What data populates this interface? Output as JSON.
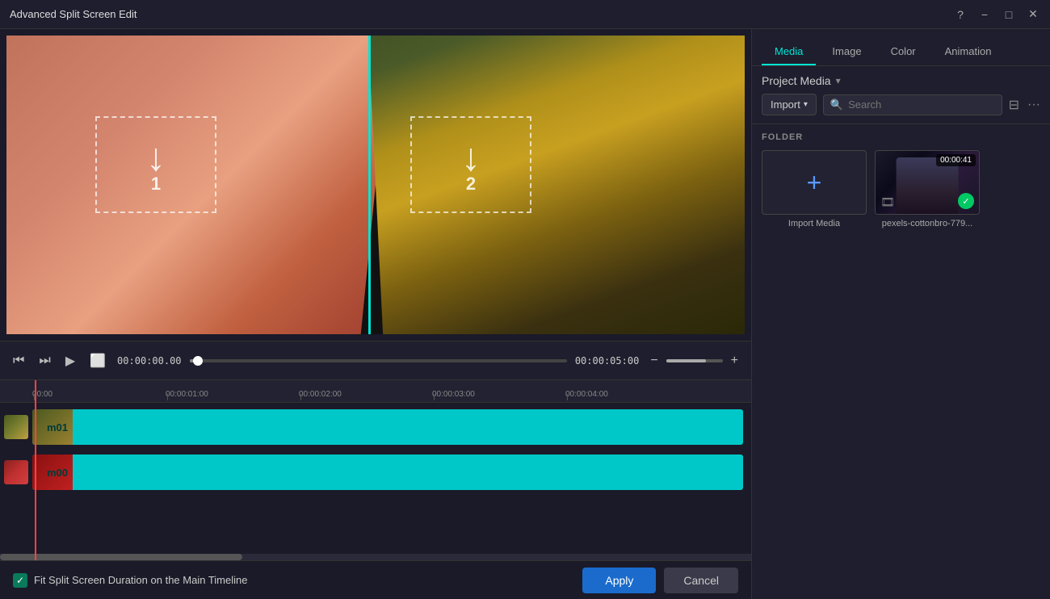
{
  "titlebar": {
    "title": "Advanced Split Screen Edit",
    "help_icon": "?",
    "minimize_icon": "−",
    "maximize_icon": "□",
    "close_icon": "✕"
  },
  "tabs": [
    {
      "id": "media",
      "label": "Media",
      "active": true
    },
    {
      "id": "image",
      "label": "Image",
      "active": false
    },
    {
      "id": "color",
      "label": "Color",
      "active": false
    },
    {
      "id": "animation",
      "label": "Animation",
      "active": false
    }
  ],
  "media_panel": {
    "dropdown_label": "Project Media",
    "import_btn_label": "Import",
    "search_placeholder": "Search",
    "folder_label": "FOLDER",
    "items": [
      {
        "id": "import",
        "label": "Import Media",
        "type": "import"
      },
      {
        "id": "video1",
        "label": "pexels-cottonbro-779...",
        "type": "video",
        "duration": "00:00:41"
      }
    ]
  },
  "playback": {
    "current_time": "00:00:00.00",
    "end_time": "00:00:05:00",
    "progress": 2
  },
  "timeline": {
    "tracks": [
      {
        "id": "m01",
        "label": "m01",
        "type": "video"
      },
      {
        "id": "m00",
        "label": "m00",
        "type": "video"
      }
    ],
    "ruler_marks": [
      "00:00",
      "00:00:01:00",
      "00:00:02:00",
      "00:00:03:00",
      "00:00:04:00"
    ]
  },
  "drop_zones": [
    {
      "number": "1"
    },
    {
      "number": "2"
    }
  ],
  "bottom_bar": {
    "checkbox_label": "Fit Split Screen Duration on the Main Timeline",
    "apply_label": "Apply",
    "cancel_label": "Cancel"
  }
}
